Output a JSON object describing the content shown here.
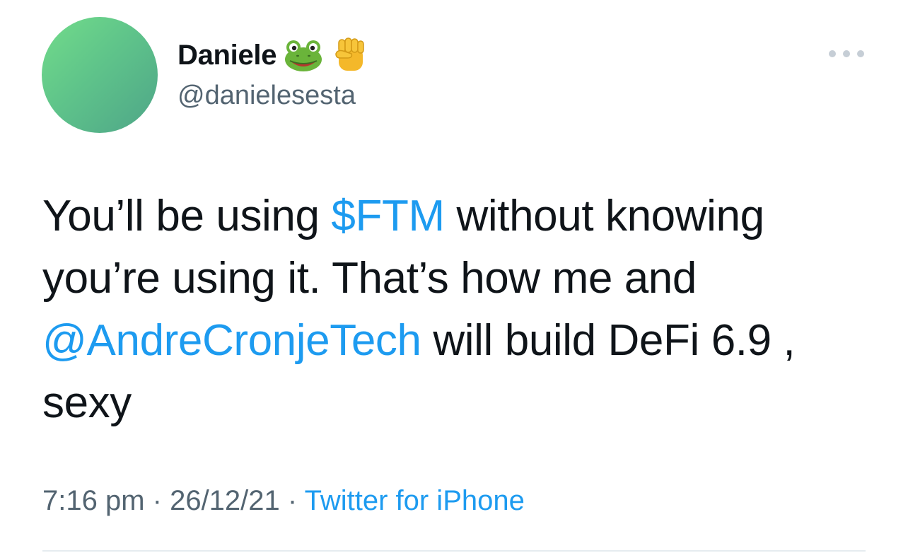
{
  "author": {
    "display_name": "Daniele",
    "handle": "@danielesesta",
    "emoji": [
      "frog-face-emoji",
      "raised-fist-emoji"
    ]
  },
  "tweet": {
    "line1_before": "You’ll be using ",
    "cashtag": "$FTM",
    "line1_after": " without knowing",
    "line2": "you’re using it. That’s how me and",
    "mention": "@AndreCronjeTech",
    "line3_after": " will build DeFi 6.9 ,",
    "line4": "sexy"
  },
  "meta": {
    "time": "7:16 pm",
    "separator1": " · ",
    "date": "26/12/21",
    "separator2": " · ",
    "source": "Twitter for iPhone"
  },
  "colors": {
    "link": "#1d9bf0",
    "secondary_text": "#536471",
    "avatar": "#5fc48a"
  }
}
